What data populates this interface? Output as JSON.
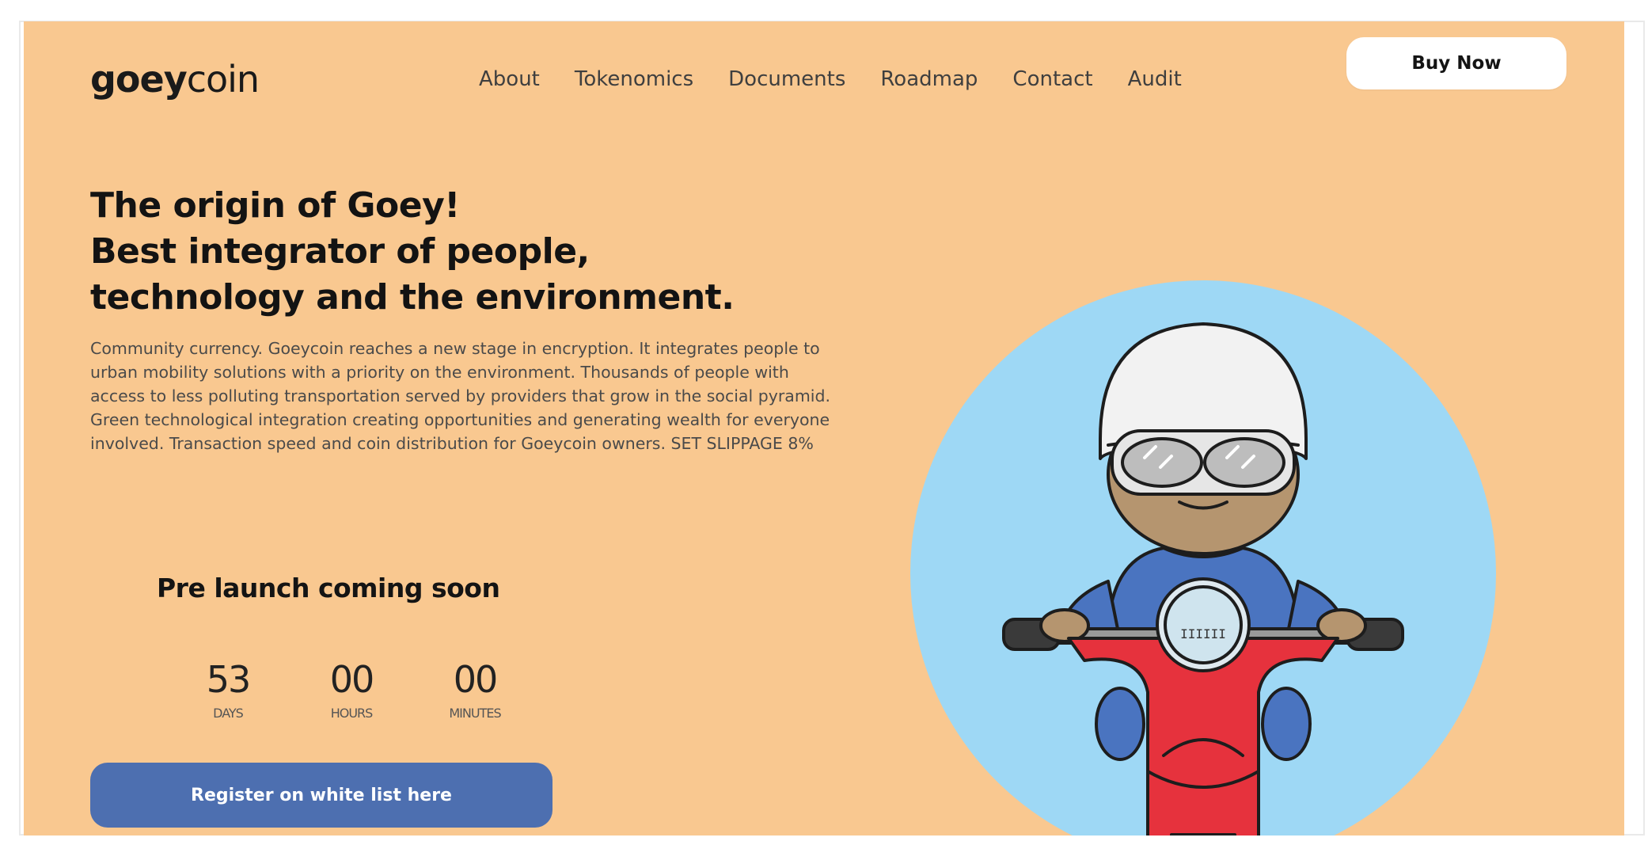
{
  "header": {
    "logo_bold": "goey",
    "logo_light": "coin",
    "nav": [
      "About",
      "Tokenomics",
      "Documents",
      "Roadmap",
      "Contact",
      "Audit"
    ],
    "buy_label": "Buy Now"
  },
  "hero": {
    "headline": [
      "The origin of Goey!",
      "Best integrator of people,",
      "technology and the environment."
    ],
    "description": "Community currency. Goeycoin reaches a new stage in encryption. It integrates people to urban mobility solutions with a priority on the environment. Thousands of people with access to less polluting transportation served by providers that grow in the social pyramid. Green technological integration creating opportunities and generating wealth for everyone involved. Transaction speed and coin distribution for Goeycoin owners. SET SLIPPAGE 8%",
    "prelaunch_title": "Pre launch coming soon",
    "countdown": [
      {
        "value": "53",
        "label": "DAYS"
      },
      {
        "value": "00",
        "label": "HOURS"
      },
      {
        "value": "00",
        "label": "MINUTES"
      }
    ],
    "register_label": "Register on white list here"
  },
  "illustration": {
    "icon": "scooter-rider-icon",
    "scooter_badge": "IIIIII"
  },
  "colors": {
    "background": "#f9c890",
    "circle": "#9ed8f5",
    "scooter": "#e6323d",
    "jacket": "#4a74c0",
    "button": "#4d6fb0"
  }
}
